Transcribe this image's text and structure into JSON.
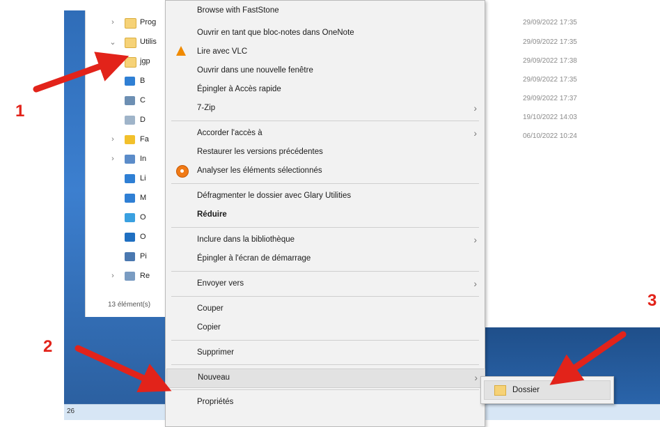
{
  "explorer": {
    "tree": [
      {
        "chevron": "›",
        "icon": "folder-icon",
        "label": "Prog",
        "color": "#f6d277"
      },
      {
        "chevron": "⌄",
        "icon": "folder-icon",
        "label": "Utilis",
        "color": "#f6d277"
      },
      {
        "chevron": "⌄",
        "icon": "folder-icon",
        "label": "jgp",
        "color": "#f6d277"
      },
      {
        "chevron": "",
        "icon": "desktop-icon",
        "label": "B",
        "color": "#2f7fd4"
      },
      {
        "chevron": "",
        "icon": "contacts-icon",
        "label": "C",
        "color": "#6d8fb3"
      },
      {
        "chevron": "",
        "icon": "document-icon",
        "label": "D",
        "color": "#9fb4c9"
      },
      {
        "chevron": "›",
        "icon": "star-icon",
        "label": "Fa",
        "color": "#f2c02b"
      },
      {
        "chevron": "›",
        "icon": "images-icon",
        "label": "In",
        "color": "#5b8cc9"
      },
      {
        "chevron": "",
        "icon": "link-icon",
        "label": "Li",
        "color": "#2f7fd4"
      },
      {
        "chevron": "",
        "icon": "music-icon",
        "label": "M",
        "color": "#2f7fd4"
      },
      {
        "chevron": "",
        "icon": "3d-object-icon",
        "label": "O",
        "color": "#3aa0e0"
      },
      {
        "chevron": "",
        "icon": "onedrive-icon",
        "label": "O",
        "color": "#1f6fc1"
      },
      {
        "chevron": "",
        "icon": "pictures-icon",
        "label": "Pi",
        "color": "#4a78b0"
      },
      {
        "chevron": "›",
        "icon": "search-icon",
        "label": "Re",
        "color": "#7a9cc2"
      }
    ],
    "status": "13 élément(s)",
    "dates": [
      "29/09/2022 17:35",
      "29/09/2022 17:35",
      "29/09/2022 17:38",
      "29/09/2022 17:35",
      "29/09/2022 17:37",
      "19/10/2022 14:03",
      "06/10/2022 10:24"
    ]
  },
  "context_menu": {
    "items": [
      {
        "label": "Browse with FastStone",
        "icon": "",
        "submenu": false
      },
      {
        "label": "Ouvrir en tant que bloc-notes dans OneNote",
        "icon": "",
        "submenu": false
      },
      {
        "label": "Lire avec VLC",
        "icon": "vlc-icon",
        "submenu": false
      },
      {
        "label": "Ouvrir dans une nouvelle fenêtre",
        "icon": "",
        "submenu": false
      },
      {
        "label": "Épingler à Accès rapide",
        "icon": "",
        "submenu": false
      },
      {
        "label": "7-Zip",
        "icon": "",
        "submenu": true
      },
      {
        "label": "Accorder l'accès à",
        "icon": "",
        "submenu": true
      },
      {
        "label": "Restaurer les versions précédentes",
        "icon": "",
        "submenu": false
      },
      {
        "label": "Analyser les éléments sélectionnés",
        "icon": "avast-icon",
        "submenu": false
      },
      {
        "label": "Défragmenter le dossier avec Glary Utilities",
        "icon": "",
        "submenu": false
      },
      {
        "label": "Réduire",
        "icon": "",
        "submenu": false,
        "bold": true
      },
      {
        "label": "Inclure dans la bibliothèque",
        "icon": "",
        "submenu": true
      },
      {
        "label": "Épingler à l'écran de démarrage",
        "icon": "",
        "submenu": false
      },
      {
        "label": "Envoyer vers",
        "icon": "",
        "submenu": true
      },
      {
        "label": "Couper",
        "icon": "",
        "submenu": false
      },
      {
        "label": "Copier",
        "icon": "",
        "submenu": false
      },
      {
        "label": "Supprimer",
        "icon": "",
        "submenu": false
      },
      {
        "label": "Nouveau",
        "icon": "",
        "submenu": true,
        "highlighted": true
      },
      {
        "label": "Propriétés",
        "icon": "",
        "submenu": false
      }
    ],
    "submenu_glyph": "›"
  },
  "submenu": {
    "item_label": "Dossier",
    "icon": "folder-icon"
  },
  "taskbar": {
    "text": "26"
  },
  "annotations": {
    "callouts": [
      "1",
      "2",
      "3"
    ],
    "arrow_color": "#e2231a"
  }
}
